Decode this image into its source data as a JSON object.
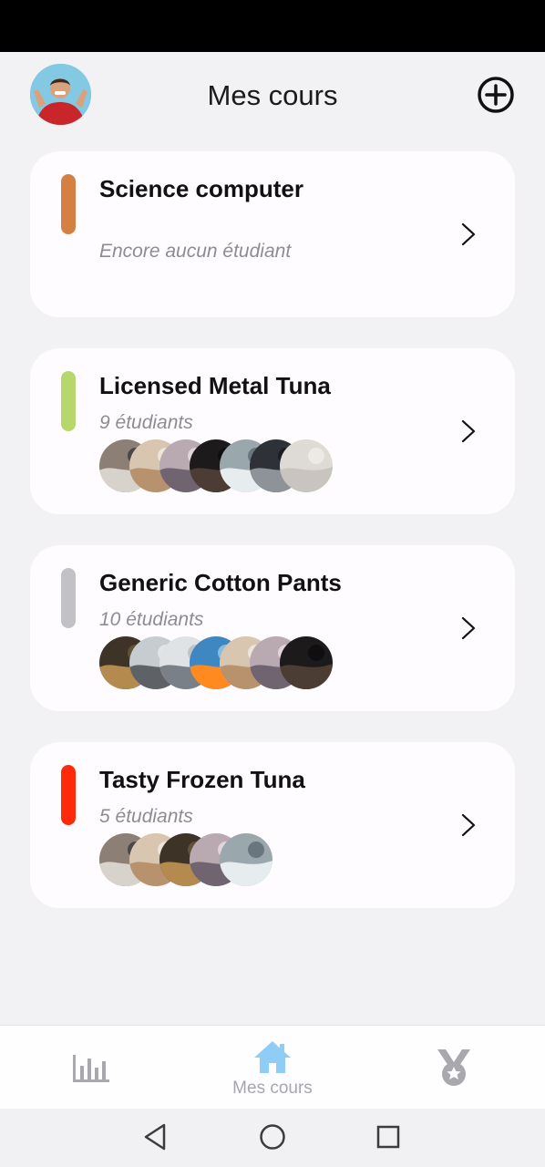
{
  "header": {
    "title": "Mes cours",
    "avatar_icon": "profile-avatar",
    "add_icon": "plus-circle-icon"
  },
  "courses": [
    {
      "title": "Science computer",
      "students_label": "Encore aucun étudiant",
      "color": "#d57f42",
      "student_avatars": []
    },
    {
      "title": "Licensed Metal Tuna",
      "students_label": "9 étudiants",
      "color": "#b7d66b",
      "student_avatars": [
        "street-photo",
        "hand-photo",
        "sea-photo",
        "dark-photo",
        "church-photo",
        "coast-photo",
        "paper-photo"
      ]
    },
    {
      "title": "Generic Cotton Pants",
      "students_label": "10 étudiants",
      "color": "#c2c1c5",
      "student_avatars": [
        "plant-photo",
        "road-photo",
        "harbor-photo",
        "building-photo",
        "hand-photo",
        "sea-photo",
        "dark-photo"
      ]
    },
    {
      "title": "Tasty Frozen Tuna",
      "students_label": "5 étudiants",
      "color": "#ff2a0a",
      "student_avatars": [
        "street-photo",
        "hand-photo",
        "plant-photo",
        "sea-photo",
        "church-photo"
      ]
    }
  ],
  "bottom_nav": {
    "stats_icon": "bar-chart-icon",
    "home_icon": "home-icon",
    "home_label": "Mes cours",
    "badges_icon": "medal-icon",
    "active_color": "#8fcdf6",
    "inactive_color": "#a9a8ae"
  },
  "system_nav": {
    "back_icon": "back-triangle-icon",
    "home_icon": "home-circle-icon",
    "recent_icon": "recent-square-icon"
  }
}
